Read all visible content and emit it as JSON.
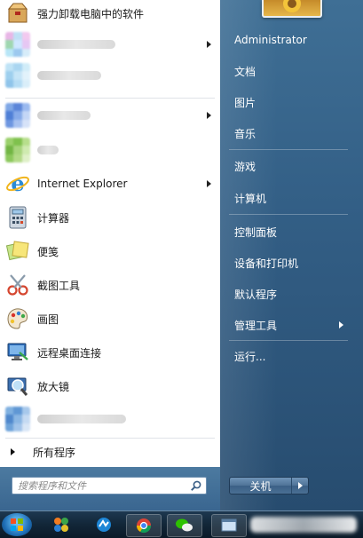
{
  "user": {
    "name": "Administrator"
  },
  "left_items": [
    {
      "label": "强力卸载电脑中的软件",
      "icon": "uninstall-box-icon",
      "arrow": false
    },
    {
      "label": "",
      "icon": "blurred-app-icon",
      "arrow": true,
      "blurred": true
    },
    {
      "label": "",
      "icon": "blurred-app-icon",
      "arrow": true,
      "blurred": true
    },
    {
      "label": "",
      "icon": "blurred-app-icon",
      "arrow": false,
      "blurred": true
    },
    {
      "label": "Internet Explorer",
      "icon": "ie-icon",
      "arrow": true
    },
    {
      "label": "计算器",
      "icon": "calculator-icon",
      "arrow": false
    },
    {
      "label": "便笺",
      "icon": "sticky-notes-icon",
      "arrow": false
    },
    {
      "label": "截图工具",
      "icon": "snipping-tool-icon",
      "arrow": false
    },
    {
      "label": "画图",
      "icon": "paint-icon",
      "arrow": false
    },
    {
      "label": "远程桌面连接",
      "icon": "remote-desktop-icon",
      "arrow": false
    },
    {
      "label": "放大镜",
      "icon": "magnifier-icon",
      "arrow": false
    },
    {
      "label": "",
      "icon": "blurred-app-icon",
      "arrow": false,
      "blurred": true
    }
  ],
  "all_programs": "所有程序",
  "search": {
    "placeholder": "搜索程序和文件"
  },
  "right_links": [
    {
      "label": "Administrator"
    },
    {
      "label": "文档"
    },
    {
      "label": "图片"
    },
    {
      "label": "音乐"
    },
    {
      "label": "游戏"
    },
    {
      "label": "计算机"
    },
    {
      "label": "控制面板"
    },
    {
      "label": "设备和打印机"
    },
    {
      "label": "默认程序"
    },
    {
      "label": "管理工具",
      "arrow": true
    },
    {
      "label": "运行..."
    }
  ],
  "shutdown": {
    "label": "关机"
  },
  "colors": {
    "accent": "#335f86",
    "taskbar": "#122638"
  }
}
